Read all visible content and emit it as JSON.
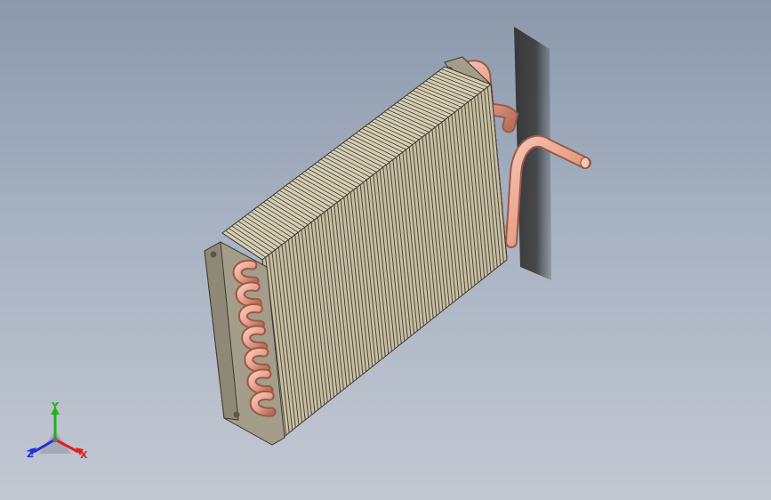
{
  "viewport": {
    "view_name": "isometric-3d-view",
    "background_top": "#8b99ab",
    "background_bottom": "#c3c8d2"
  },
  "model": {
    "fin_color": "#c8bfa3",
    "fin_edge_color": "#3d3a30",
    "tube_color": "#e8a08a",
    "plate_color": "#a49d8a"
  },
  "triad": {
    "x_label": "X",
    "y_label": "Y",
    "z_label": "Z",
    "x_color": "#e0201b",
    "y_color": "#1fb31f",
    "z_color": "#1f2fd8"
  }
}
